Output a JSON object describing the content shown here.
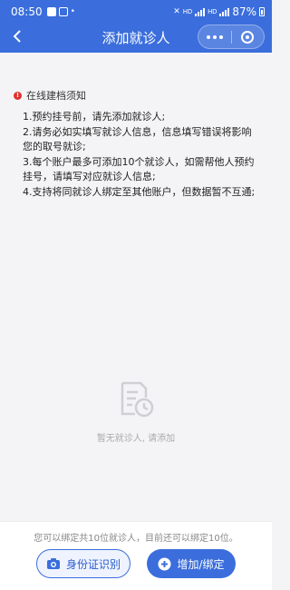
{
  "status_bar": {
    "time": "08:50",
    "network_1": "HD",
    "network_2": "HD",
    "battery": "87%"
  },
  "nav": {
    "title": "添加就诊人",
    "icons": [
      "back-arrow-icon",
      "more-dots-icon",
      "close-ring-icon"
    ]
  },
  "notice": {
    "title": "在线建档须知",
    "items": [
      "1.预约挂号前，请先添加就诊人;",
      "2.请务必如实填写就诊人信息，信息填写错误将影响您的取号就诊;",
      "3.每个账户最多可添加10个就诊人，如需帮他人预约挂号，请填写对应就诊人信息;",
      "4.支持将同就诊人绑定至其他账户，但数据暂不互通;"
    ]
  },
  "empty_state": {
    "text": "暂无就诊人, 请添加",
    "icon": "document-clock-icon"
  },
  "footer": {
    "note": "您可以绑定共10位就诊人，目前还可以绑定10位。",
    "id_button_label": "身份证识别",
    "add_button_label": "增加/绑定"
  },
  "colors": {
    "primary": "#3b6edc",
    "background": "#f4f4f6",
    "notice_red": "#e0312f"
  }
}
